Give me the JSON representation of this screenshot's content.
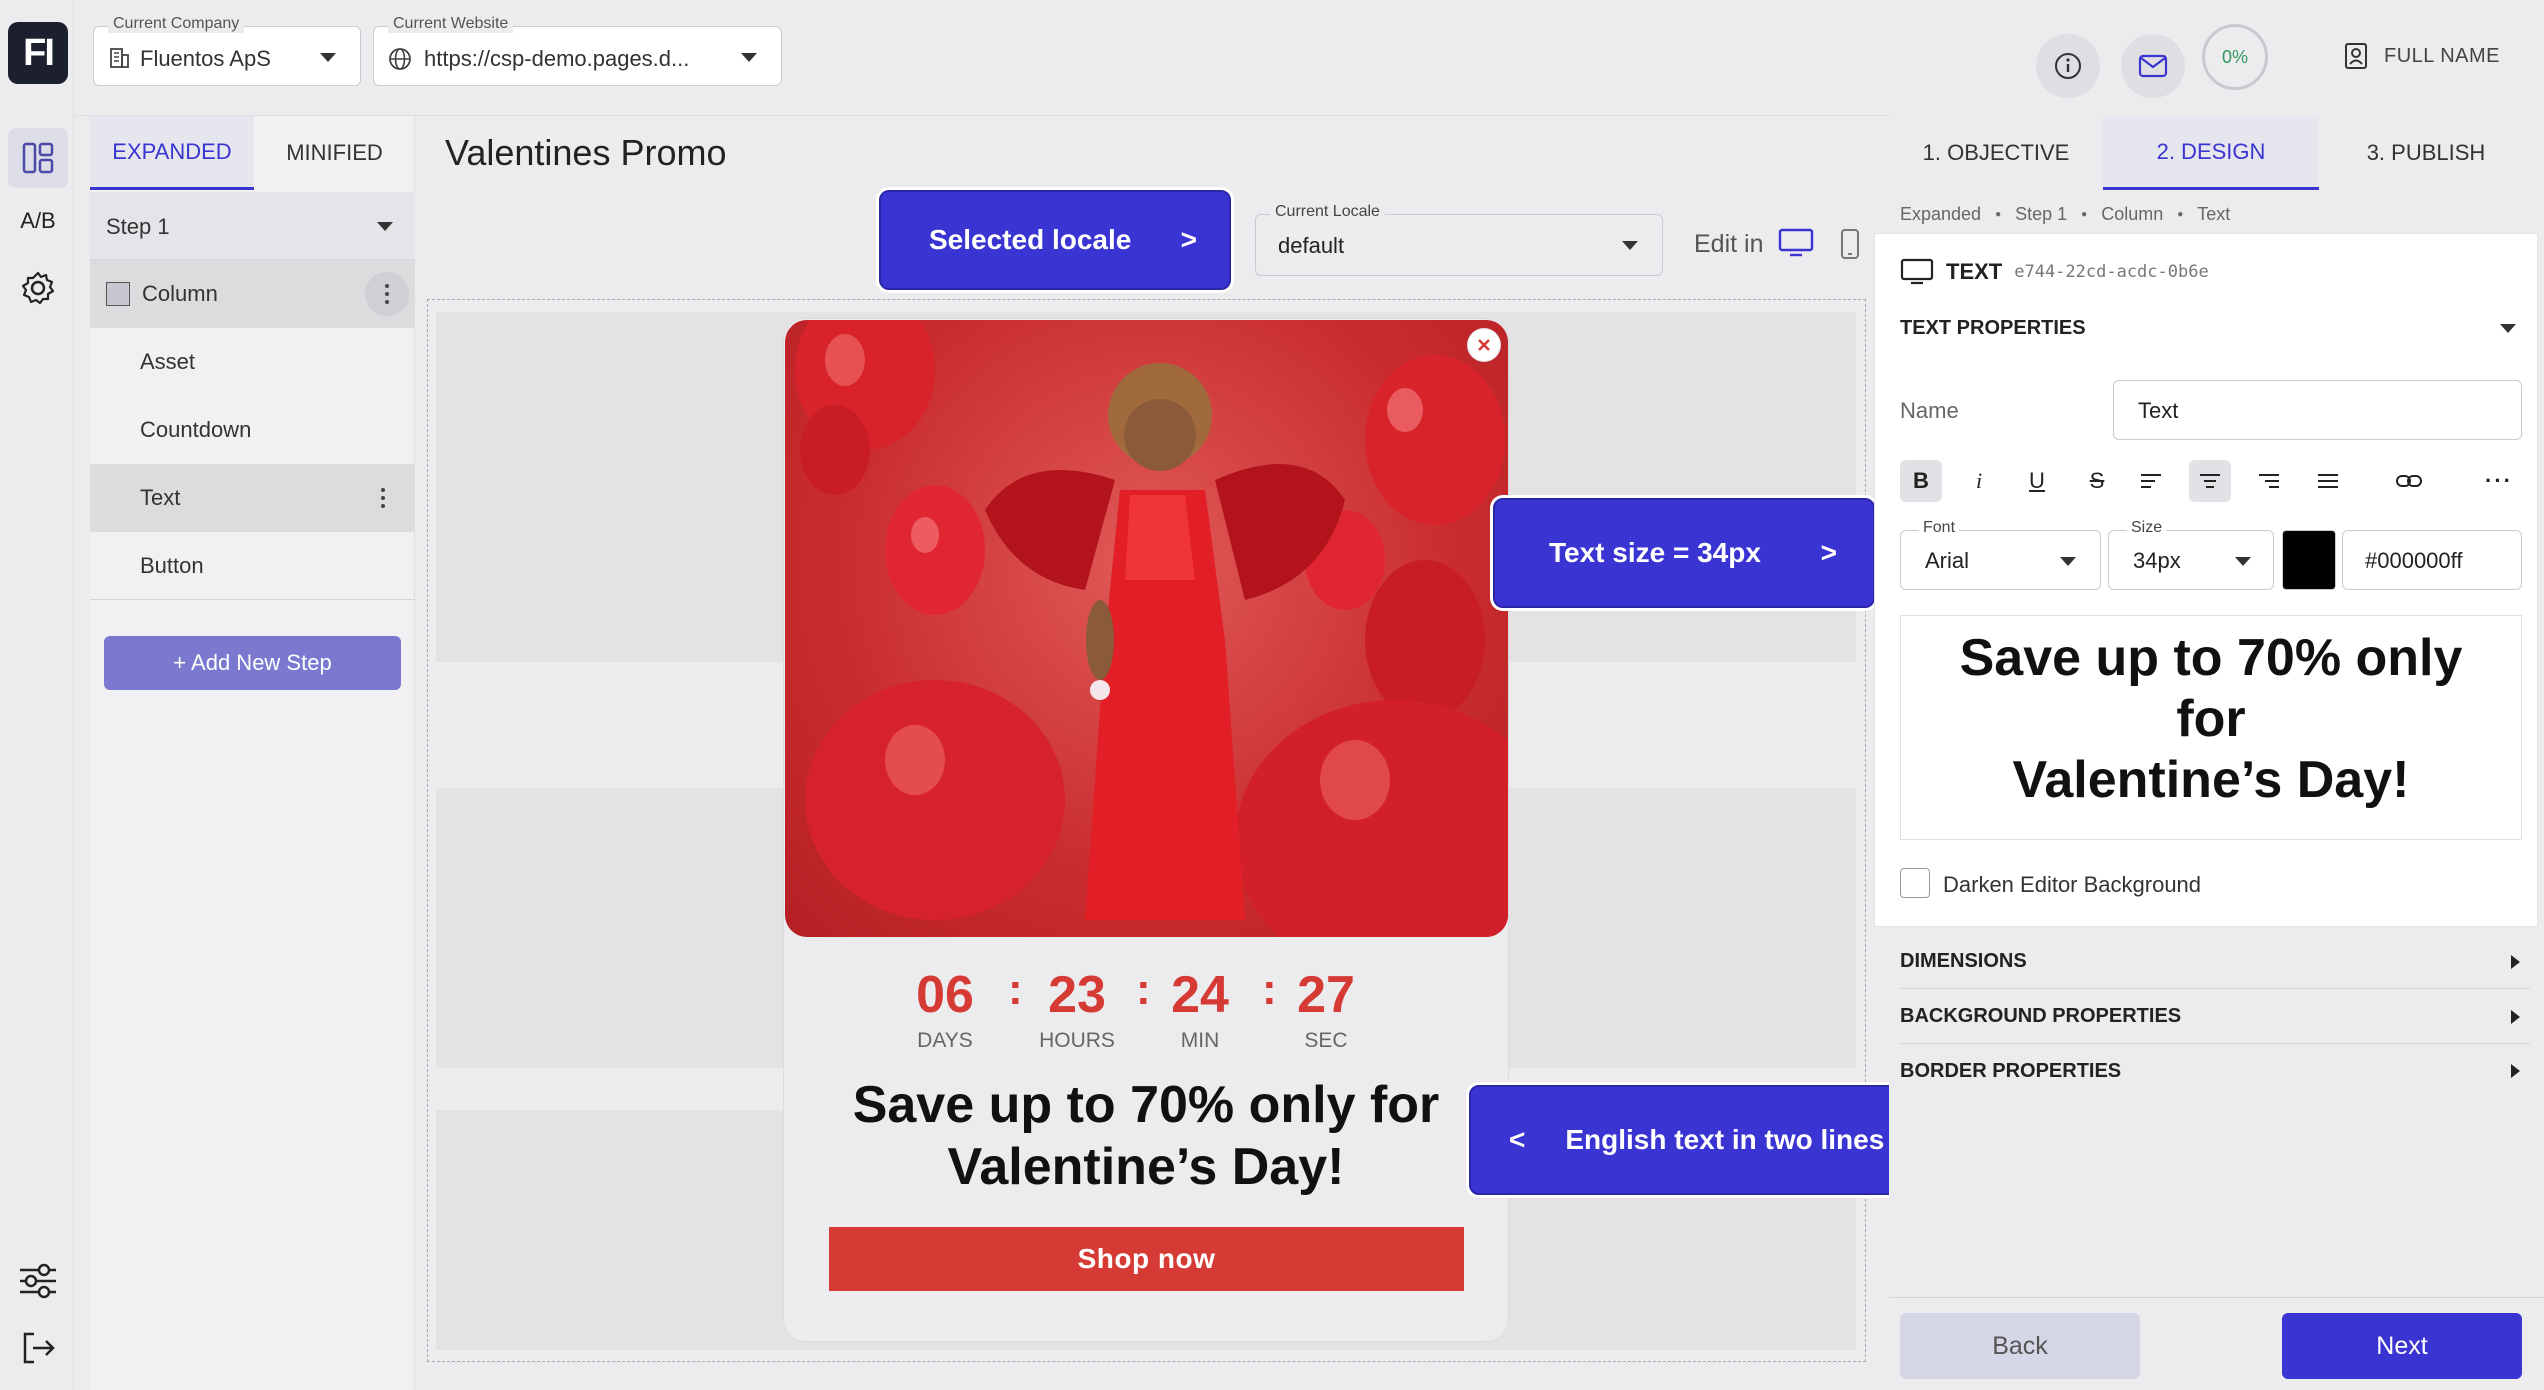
{
  "logo": "FI",
  "header": {
    "company_label": "Current Company",
    "company_value": "Fluentos ApS",
    "website_label": "Current Website",
    "website_value": "https://csp-demo.pages.d...",
    "progress": "0%",
    "user_name": "FULL NAME"
  },
  "left_rail": {
    "ab_label": "A/B"
  },
  "left_panel": {
    "tabs": [
      "EXPANDED",
      "MINIFIED"
    ],
    "step_select": "Step 1",
    "tree": [
      "Column",
      "Asset",
      "Countdown",
      "Text",
      "Button"
    ],
    "add_step": "+ Add New Step"
  },
  "canvas": {
    "page_title": "Valentines Promo",
    "locale_label": "Current Locale",
    "locale_value": "default",
    "edit_in": "Edit in"
  },
  "popup": {
    "countdown": [
      {
        "value": "06",
        "unit": "DAYS"
      },
      {
        "value": "23",
        "unit": "HOURS"
      },
      {
        "value": "24",
        "unit": "MIN"
      },
      {
        "value": "27",
        "unit": "SEC"
      }
    ],
    "headline_line1": "Save up to 70% only for",
    "headline_line2": "Valentine’s Day!",
    "cta": "Shop now",
    "accent": "#d63a35"
  },
  "callouts": {
    "locale": "Selected locale",
    "locale_arrow": ">",
    "text_size": "Text size = 34px",
    "text_size_arrow": ">",
    "english": "English text in two lines",
    "english_arrow": "<"
  },
  "right_panel": {
    "tabs": [
      "1. OBJECTIVE",
      "2. DESIGN",
      "3. PUBLISH"
    ],
    "breadcrumb": [
      "Expanded",
      "Step 1",
      "Column",
      "Text"
    ],
    "element_type": "TEXT",
    "element_id": "e744-22cd-acdc-0b6e",
    "text_properties": "TEXT PROPERTIES",
    "name_label": "Name",
    "name_value": "Text",
    "font_label": "Font",
    "font_value": "Arial",
    "size_label": "Size",
    "size_value": "34px",
    "color_value": "#000000ff",
    "preview_line1": "Save up to 70% only",
    "preview_line2": "for",
    "preview_line3": "Valentine’s Day!",
    "darken_label": "Darken Editor Background",
    "sections": [
      "DIMENSIONS",
      "BACKGROUND PROPERTIES",
      "BORDER PROPERTIES"
    ],
    "back": "Back",
    "next": "Next"
  },
  "colors": {
    "primary": "#3a34d2",
    "tab_active": "#3a34d2",
    "countdown": "#d63a35"
  }
}
